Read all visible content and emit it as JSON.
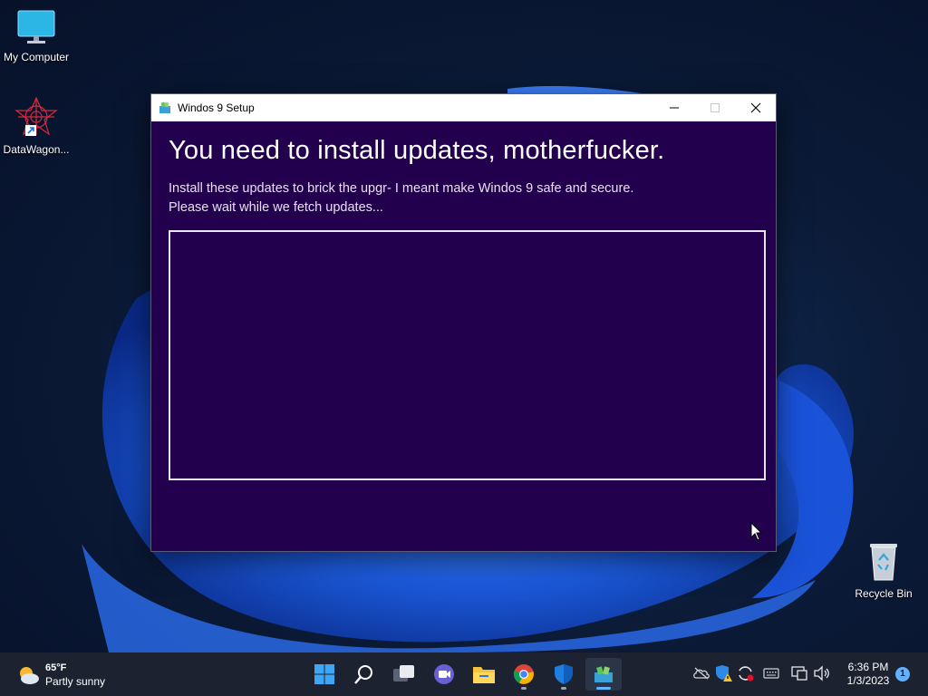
{
  "desktop": {
    "icons": [
      {
        "label": "My Computer",
        "icon": "monitor-icon"
      },
      {
        "label": "DataWagon...",
        "icon": "datawagon-shortcut-icon"
      },
      {
        "label": "Recycle Bin",
        "icon": "recycle-bin-icon"
      }
    ]
  },
  "window": {
    "title": "Windos 9 Setup",
    "heading": "You need to install updates, motherfucker.",
    "line1": "Install these updates to brick the upgr- I meant make Windos 9 safe and secure.",
    "line2": "Please wait while we fetch updates..."
  },
  "taskbar": {
    "weather_temp": "65°F",
    "weather_desc": "Partly sunny",
    "clock_time": "6:36 PM",
    "clock_date": "1/3/2023",
    "notification_count": "1",
    "apps": [
      "start-icon",
      "search-icon",
      "task-view-icon",
      "chat-icon",
      "file-explorer-icon",
      "chrome-icon",
      "defender-icon",
      "setup-app-icon"
    ]
  },
  "colors": {
    "window_bg": "#22004e",
    "accent": "#5fb2ff",
    "taskbar": "#1c2230"
  }
}
